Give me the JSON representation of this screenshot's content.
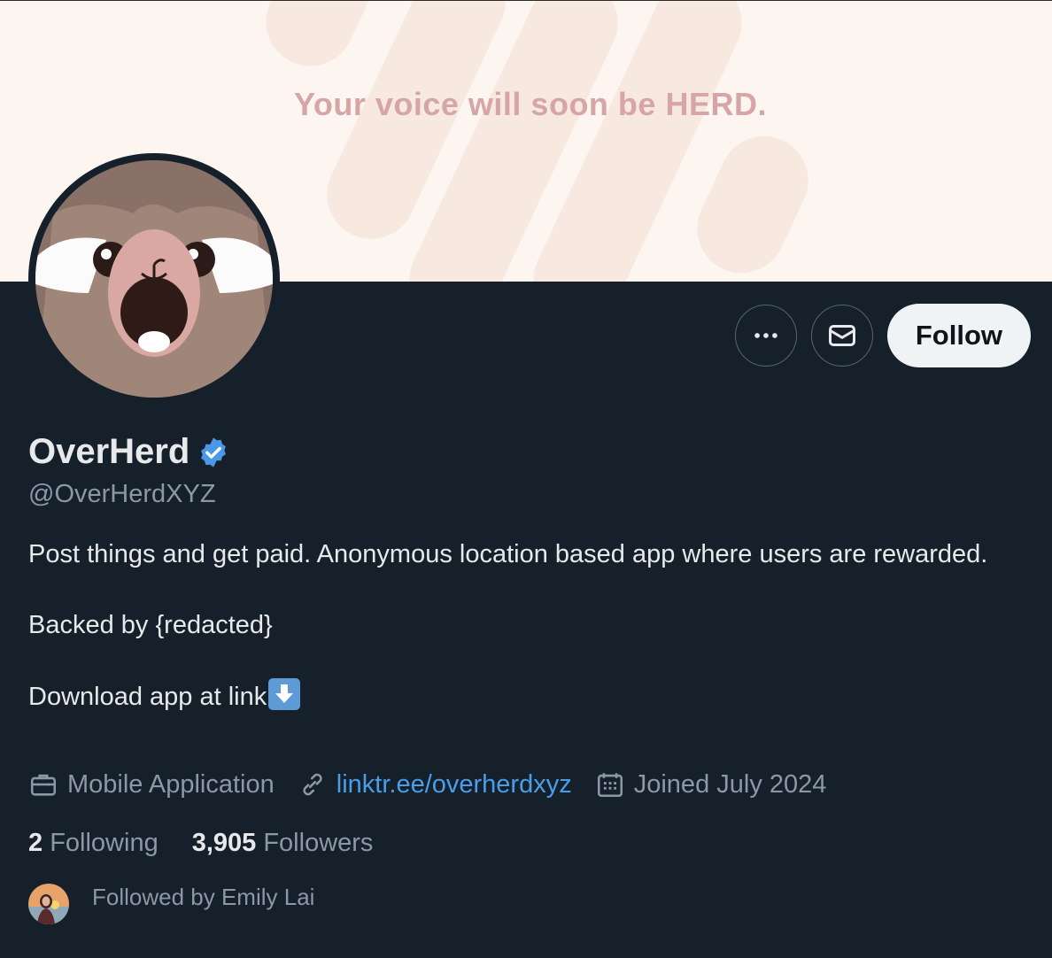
{
  "banner": {
    "text": "Your voice will soon be HERD."
  },
  "actions": {
    "more_icon": "more-horizontal-icon",
    "message_icon": "envelope-icon",
    "follow_label": "Follow"
  },
  "profile": {
    "name": "OverHerd",
    "verified_icon": "verified-badge-icon",
    "handle": "@OverHerdXYZ",
    "bio": {
      "line1": "Post things and get paid. Anonymous location based app where users are rewarded.",
      "line2": "Backed by {redacted}",
      "line3": "Download app at link"
    },
    "category": "Mobile Application",
    "link": "linktr.ee/overherdxyz",
    "joined": "Joined July 2024"
  },
  "stats": {
    "following_count": "2",
    "following_label": "Following",
    "followers_count": "3,905",
    "followers_label": "Followers"
  },
  "followed_by": {
    "text": "Followed by Emily Lai"
  },
  "colors": {
    "background": "#15202b",
    "banner": "#fcf5f0",
    "banner_text": "#d7a5a5",
    "link": "#4a9ee8",
    "verified": "#4a99e9",
    "secondary_text": "#8b98a5"
  }
}
